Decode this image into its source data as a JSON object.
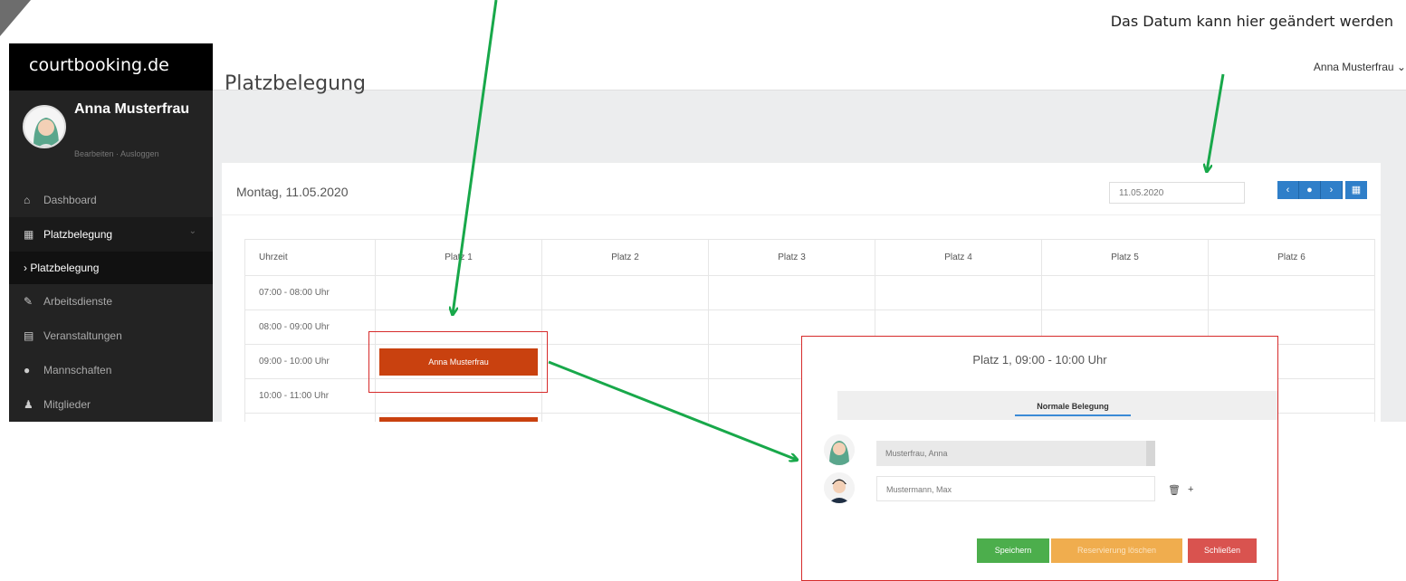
{
  "annotation": {
    "date_note": "Das Datum kann hier geändert werden"
  },
  "sidebar": {
    "brand": "courtbooking.de",
    "user_name": "Anna Musterfrau",
    "user_links": "Bearbeiten · Ausloggen",
    "items": [
      {
        "label": "Dashboard",
        "icon": "home-icon"
      },
      {
        "label": "Platzbelegung",
        "icon": "calendar-icon"
      },
      {
        "label": "Arbeitsdienste",
        "icon": "wrench-icon"
      },
      {
        "label": "Veranstaltungen",
        "icon": "map-icon"
      },
      {
        "label": "Mannschaften",
        "icon": "group-icon"
      },
      {
        "label": "Mitglieder",
        "icon": "person-icon"
      }
    ],
    "sub_item": "› Platzbelegung"
  },
  "topbar": {
    "user": "Anna Musterfrau ⌄"
  },
  "main": {
    "title": "Platzbelegung",
    "date_label": "Montag, 11.05.2020",
    "date_value": "11.05.2020",
    "nav_buttons": [
      "‹",
      "●",
      "›",
      "▦"
    ]
  },
  "grid": {
    "headers": [
      "Uhrzeit",
      "Platz 1",
      "Platz 2",
      "Platz 3",
      "Platz 4",
      "Platz 5",
      "Platz 6"
    ],
    "times": [
      "07:00 - 08:00 Uhr",
      "08:00 - 09:00 Uhr",
      "09:00 - 10:00 Uhr",
      "10:00 - 11:00 Uhr"
    ],
    "booking_label": "Anna Musterfrau"
  },
  "dialog": {
    "title": "Platz 1, 09:00 - 10:00 Uhr",
    "tab": "Normale Belegung",
    "player1": "Musterfrau, Anna",
    "player2": "Mustermann, Max",
    "actions": [
      "🗑",
      "+"
    ],
    "save": "Speichern",
    "delete": "Reservierung löschen",
    "close": "Schließen"
  },
  "colors": {
    "booking": "#c9410f",
    "annotation_arrow": "#18a84a",
    "highlight_box": "#d62b2b"
  }
}
